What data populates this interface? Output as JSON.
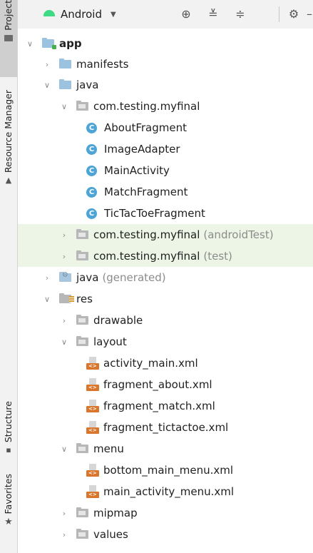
{
  "side_tabs": {
    "project": "Project",
    "resource_manager": "Resource Manager",
    "structure": "Structure",
    "favorites": "Favorites"
  },
  "toolbar": {
    "view_selector": "Android"
  },
  "tree": {
    "app": "app",
    "manifests": "manifests",
    "java": "java",
    "pkg_main": "com.testing.myfinal",
    "classes": [
      "AboutFragment",
      "ImageAdapter",
      "MainActivity",
      "MatchFragment",
      "TicTacToeFragment"
    ],
    "pkg_android_test": "com.testing.myfinal",
    "pkg_android_test_suffix": "(androidTest)",
    "pkg_test": "com.testing.myfinal",
    "pkg_test_suffix": "(test)",
    "java_generated": "java",
    "java_generated_suffix": "(generated)",
    "res": "res",
    "drawable": "drawable",
    "layout": "layout",
    "layout_files": [
      "activity_main.xml",
      "fragment_about.xml",
      "fragment_match.xml",
      "fragment_tictactoe.xml"
    ],
    "menu": "menu",
    "menu_files": [
      "bottom_main_menu.xml",
      "main_activity_menu.xml"
    ],
    "mipmap": "mipmap",
    "values": "values"
  }
}
